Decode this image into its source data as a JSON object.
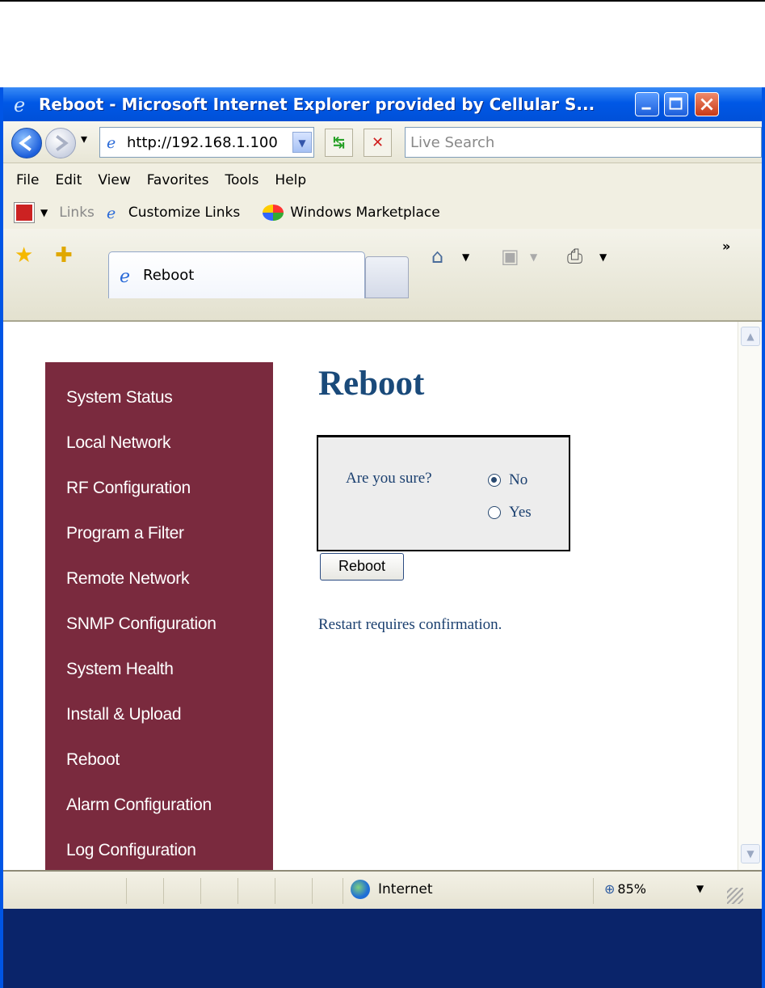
{
  "window": {
    "title": "Reboot - Microsoft Internet Explorer provided by Cellular S..."
  },
  "toolbar": {
    "address": "http://192.168.1.100",
    "search_placeholder": "Live Search"
  },
  "menu": [
    "File",
    "Edit",
    "View",
    "Favorites",
    "Tools",
    "Help"
  ],
  "links": {
    "label": "Links",
    "items": [
      "Customize Links",
      "Windows Marketplace"
    ]
  },
  "tab": {
    "label": "Reboot"
  },
  "sidebar": {
    "items": [
      "System Status",
      "Local Network",
      "RF Configuration",
      "Program a Filter",
      "Remote Network",
      "SNMP Configuration",
      "System Health",
      "Install & Upload",
      "Reboot",
      "Alarm Configuration",
      "Log Configuration"
    ]
  },
  "main": {
    "heading": "Reboot",
    "question": "Are you sure?",
    "option_no": "No",
    "option_yes": "Yes",
    "selected": "No",
    "button": "Reboot",
    "message": "Restart requires confirmation."
  },
  "status": {
    "zone": "Internet",
    "zoom": "85%"
  },
  "colors": {
    "sidebar": "#7a2a3e",
    "heading": "#1a4a7a",
    "titlebar": "#0058e6"
  }
}
